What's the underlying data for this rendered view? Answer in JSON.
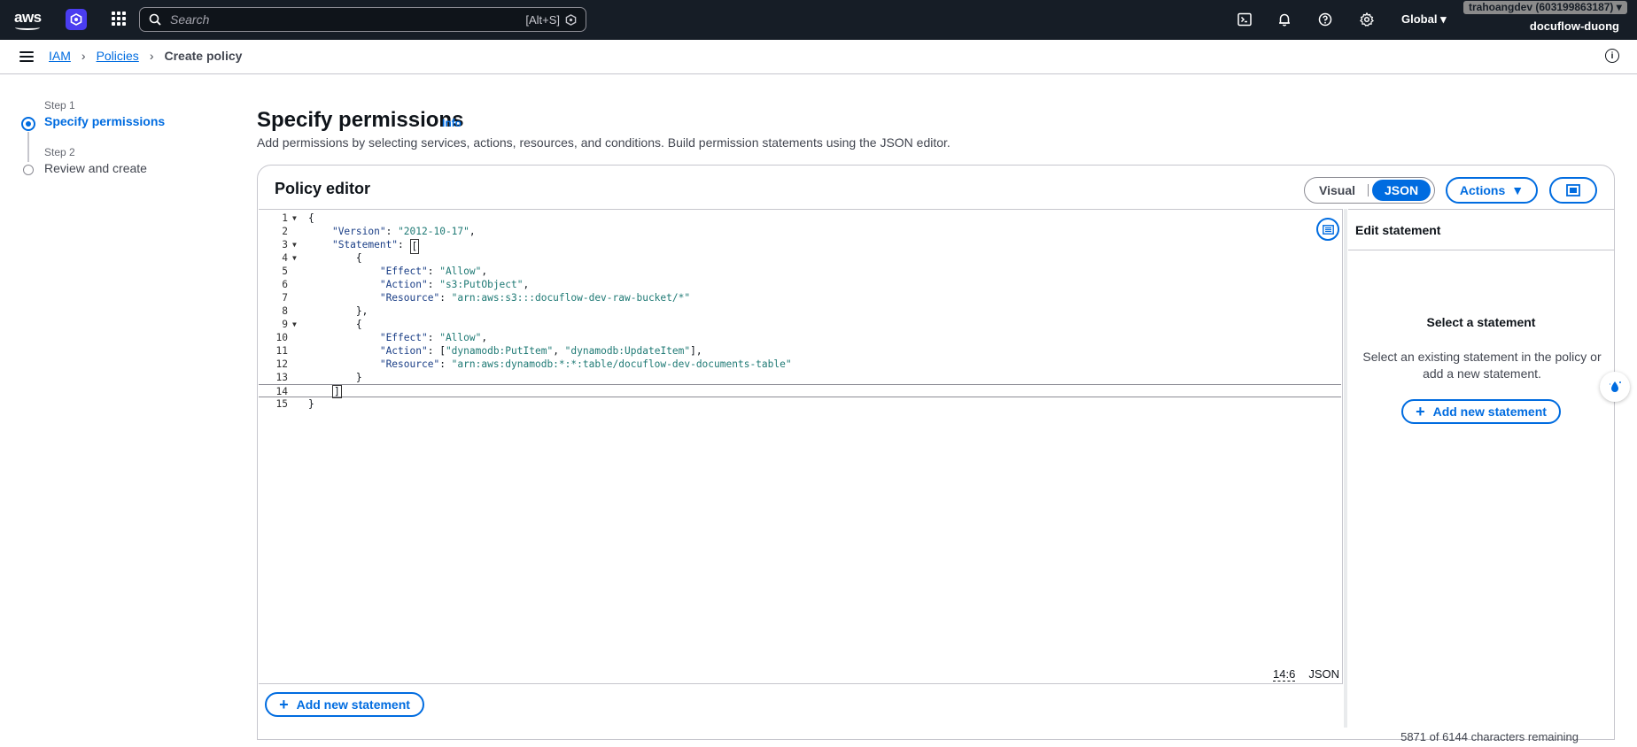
{
  "topnav": {
    "logo_text": "aws",
    "search_placeholder": "Search",
    "search_shortcut": "[Alt+S]",
    "region": "Global",
    "account_badge": "trahoangdev (603199863187)",
    "account_name": "docuflow-duong",
    "icons": [
      "cloudshell-icon",
      "bell-icon",
      "help-icon",
      "gear-icon"
    ]
  },
  "breadcrumb": {
    "items": [
      "IAM",
      "Policies"
    ],
    "current": "Create policy"
  },
  "steps": [
    {
      "kicker": "Step 1",
      "title": "Specify permissions"
    },
    {
      "kicker": "Step 2",
      "title": "Review and create"
    }
  ],
  "header": {
    "title": "Specify permissions",
    "info": "Info",
    "description": "Add permissions by selecting services, actions, resources, and conditions. Build permission statements using the JSON editor."
  },
  "editor": {
    "title": "Policy editor",
    "mode_visual": "Visual",
    "mode_json": "JSON",
    "actions_label": "Actions",
    "cursor_position": "14:6",
    "language": "JSON",
    "add_statement_label": "Add new statement",
    "chars_remaining": "5871 of 6144 characters remaining",
    "lines": [
      {
        "n": "1",
        "fold": true,
        "text": "{"
      },
      {
        "n": "2",
        "fold": false,
        "text": "    \"Version\": \"2012-10-17\","
      },
      {
        "n": "3",
        "fold": true,
        "text": "    \"Statement\": ["
      },
      {
        "n": "4",
        "fold": true,
        "text": "        {"
      },
      {
        "n": "5",
        "fold": false,
        "text": "            \"Effect\": \"Allow\","
      },
      {
        "n": "6",
        "fold": false,
        "text": "            \"Action\": \"s3:PutObject\","
      },
      {
        "n": "7",
        "fold": false,
        "text": "            \"Resource\": \"arn:aws:s3:::docuflow-dev-raw-bucket/*\""
      },
      {
        "n": "8",
        "fold": false,
        "text": "        },"
      },
      {
        "n": "9",
        "fold": true,
        "text": "        {"
      },
      {
        "n": "10",
        "fold": false,
        "text": "            \"Effect\": \"Allow\","
      },
      {
        "n": "11",
        "fold": false,
        "text": "            \"Action\": [\"dynamodb:PutItem\", \"dynamodb:UpdateItem\"],"
      },
      {
        "n": "12",
        "fold": false,
        "text": "            \"Resource\": \"arn:aws:dynamodb:*:*:table/docuflow-dev-documents-table\""
      },
      {
        "n": "13",
        "fold": false,
        "text": "        }"
      },
      {
        "n": "14",
        "fold": false,
        "text": "    ]"
      },
      {
        "n": "15",
        "fold": false,
        "text": "}"
      }
    ]
  },
  "side_panel": {
    "header": "Edit statement",
    "title": "Select a statement",
    "description": "Select an existing statement in the policy or add a new statement.",
    "add_label": "Add new statement"
  }
}
